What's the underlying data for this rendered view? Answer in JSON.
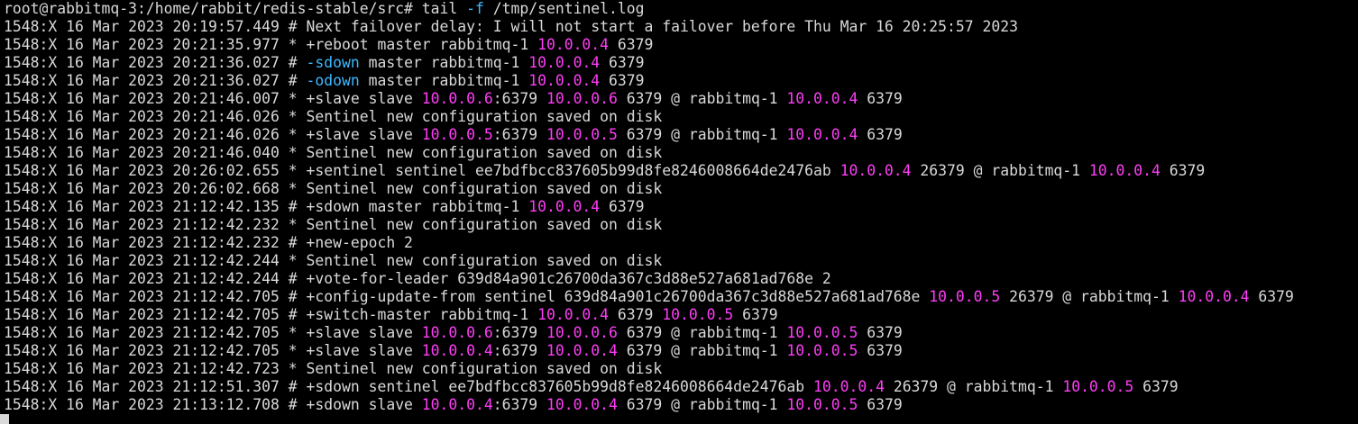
{
  "colors": {
    "background": "#000000",
    "foreground": "#d9d9d9",
    "ip": "#ff3df7",
    "flag": "#3db8ff"
  },
  "prompt": [
    {
      "text": "root@rabbitmq-3:/home/rabbit/redis-stable/src# tail ",
      "color": "fg"
    },
    {
      "text": "-f",
      "color": "flag"
    },
    {
      "text": " /tmp/sentinel.log",
      "color": "fg"
    }
  ],
  "log_lines": [
    [
      {
        "text": "1548:X 16 Mar 2023 20:19:57.449 # Next failover delay: I will not start a failover before Thu Mar 16 20:25:57 2023",
        "color": "fg"
      }
    ],
    [
      {
        "text": "1548:X 16 Mar 2023 20:21:35.977 * +reboot master rabbitmq-1 ",
        "color": "fg"
      },
      {
        "text": "10.0.0.4",
        "color": "ip"
      },
      {
        "text": " 6379",
        "color": "fg"
      }
    ],
    [
      {
        "text": "1548:X 16 Mar 2023 20:21:36.027 # ",
        "color": "fg"
      },
      {
        "text": "-sdown",
        "color": "flag"
      },
      {
        "text": " master rabbitmq-1 ",
        "color": "fg"
      },
      {
        "text": "10.0.0.4",
        "color": "ip"
      },
      {
        "text": " 6379",
        "color": "fg"
      }
    ],
    [
      {
        "text": "1548:X 16 Mar 2023 20:21:36.027 # ",
        "color": "fg"
      },
      {
        "text": "-odown",
        "color": "flag"
      },
      {
        "text": " master rabbitmq-1 ",
        "color": "fg"
      },
      {
        "text": "10.0.0.4",
        "color": "ip"
      },
      {
        "text": " 6379",
        "color": "fg"
      }
    ],
    [
      {
        "text": "1548:X 16 Mar 2023 20:21:46.007 * +slave slave ",
        "color": "fg"
      },
      {
        "text": "10.0.0.6",
        "color": "ip"
      },
      {
        "text": ":6379 ",
        "color": "fg"
      },
      {
        "text": "10.0.0.6",
        "color": "ip"
      },
      {
        "text": " 6379 @ rabbitmq-1 ",
        "color": "fg"
      },
      {
        "text": "10.0.0.4",
        "color": "ip"
      },
      {
        "text": " 6379",
        "color": "fg"
      }
    ],
    [
      {
        "text": "1548:X 16 Mar 2023 20:21:46.026 * Sentinel new configuration saved on disk",
        "color": "fg"
      }
    ],
    [
      {
        "text": "1548:X 16 Mar 2023 20:21:46.026 * +slave slave ",
        "color": "fg"
      },
      {
        "text": "10.0.0.5",
        "color": "ip"
      },
      {
        "text": ":6379 ",
        "color": "fg"
      },
      {
        "text": "10.0.0.5",
        "color": "ip"
      },
      {
        "text": " 6379 @ rabbitmq-1 ",
        "color": "fg"
      },
      {
        "text": "10.0.0.4",
        "color": "ip"
      },
      {
        "text": " 6379",
        "color": "fg"
      }
    ],
    [
      {
        "text": "1548:X 16 Mar 2023 20:21:46.040 * Sentinel new configuration saved on disk",
        "color": "fg"
      }
    ],
    [
      {
        "text": "1548:X 16 Mar 2023 20:26:02.655 * +sentinel sentinel ee7bdfbcc837605b99d8fe8246008664de2476ab ",
        "color": "fg"
      },
      {
        "text": "10.0.0.4",
        "color": "ip"
      },
      {
        "text": " 26379 @ rabbitmq-1 ",
        "color": "fg"
      },
      {
        "text": "10.0.0.4",
        "color": "ip"
      },
      {
        "text": " 6379",
        "color": "fg"
      }
    ],
    [
      {
        "text": "1548:X 16 Mar 2023 20:26:02.668 * Sentinel new configuration saved on disk",
        "color": "fg"
      }
    ],
    [
      {
        "text": "1548:X 16 Mar 2023 21:12:42.135 # +sdown master rabbitmq-1 ",
        "color": "fg"
      },
      {
        "text": "10.0.0.4",
        "color": "ip"
      },
      {
        "text": " 6379",
        "color": "fg"
      }
    ],
    [
      {
        "text": "1548:X 16 Mar 2023 21:12:42.232 * Sentinel new configuration saved on disk",
        "color": "fg"
      }
    ],
    [
      {
        "text": "1548:X 16 Mar 2023 21:12:42.232 # +new-epoch 2",
        "color": "fg"
      }
    ],
    [
      {
        "text": "1548:X 16 Mar 2023 21:12:42.244 * Sentinel new configuration saved on disk",
        "color": "fg"
      }
    ],
    [
      {
        "text": "1548:X 16 Mar 2023 21:12:42.244 # +vote-for-leader 639d84a901c26700da367c3d88e527a681ad768e 2",
        "color": "fg"
      }
    ],
    [
      {
        "text": "1548:X 16 Mar 2023 21:12:42.705 # +config-update-from sentinel 639d84a901c26700da367c3d88e527a681ad768e ",
        "color": "fg"
      },
      {
        "text": "10.0.0.5",
        "color": "ip"
      },
      {
        "text": " 26379 @ rabbitmq-1 ",
        "color": "fg"
      },
      {
        "text": "10.0.0.4",
        "color": "ip"
      },
      {
        "text": " 6379",
        "color": "fg"
      }
    ],
    [
      {
        "text": "1548:X 16 Mar 2023 21:12:42.705 # +switch-master rabbitmq-1 ",
        "color": "fg"
      },
      {
        "text": "10.0.0.4",
        "color": "ip"
      },
      {
        "text": " 6379 ",
        "color": "fg"
      },
      {
        "text": "10.0.0.5",
        "color": "ip"
      },
      {
        "text": " 6379",
        "color": "fg"
      }
    ],
    [
      {
        "text": "1548:X 16 Mar 2023 21:12:42.705 * +slave slave ",
        "color": "fg"
      },
      {
        "text": "10.0.0.6",
        "color": "ip"
      },
      {
        "text": ":6379 ",
        "color": "fg"
      },
      {
        "text": "10.0.0.6",
        "color": "ip"
      },
      {
        "text": " 6379 @ rabbitmq-1 ",
        "color": "fg"
      },
      {
        "text": "10.0.0.5",
        "color": "ip"
      },
      {
        "text": " 6379",
        "color": "fg"
      }
    ],
    [
      {
        "text": "1548:X 16 Mar 2023 21:12:42.705 * +slave slave ",
        "color": "fg"
      },
      {
        "text": "10.0.0.4",
        "color": "ip"
      },
      {
        "text": ":6379 ",
        "color": "fg"
      },
      {
        "text": "10.0.0.4",
        "color": "ip"
      },
      {
        "text": " 6379 @ rabbitmq-1 ",
        "color": "fg"
      },
      {
        "text": "10.0.0.5",
        "color": "ip"
      },
      {
        "text": " 6379",
        "color": "fg"
      }
    ],
    [
      {
        "text": "1548:X 16 Mar 2023 21:12:42.723 * Sentinel new configuration saved on disk",
        "color": "fg"
      }
    ],
    [
      {
        "text": "1548:X 16 Mar 2023 21:12:51.307 # +sdown sentinel ee7bdfbcc837605b99d8fe8246008664de2476ab ",
        "color": "fg"
      },
      {
        "text": "10.0.0.4",
        "color": "ip"
      },
      {
        "text": " 26379 @ rabbitmq-1 ",
        "color": "fg"
      },
      {
        "text": "10.0.0.5",
        "color": "ip"
      },
      {
        "text": " 6379",
        "color": "fg"
      }
    ],
    [
      {
        "text": "1548:X 16 Mar 2023 21:13:12.708 # +sdown slave ",
        "color": "fg"
      },
      {
        "text": "10.0.0.4",
        "color": "ip"
      },
      {
        "text": ":6379 ",
        "color": "fg"
      },
      {
        "text": "10.0.0.4",
        "color": "ip"
      },
      {
        "text": " 6379 @ rabbitmq-1 ",
        "color": "fg"
      },
      {
        "text": "10.0.0.5",
        "color": "ip"
      },
      {
        "text": " 6379",
        "color": "fg"
      }
    ]
  ]
}
